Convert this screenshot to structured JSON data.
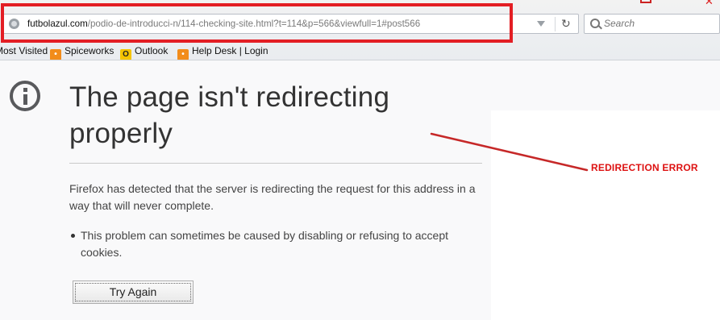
{
  "browser": {
    "url": {
      "host": "futbolazul.com",
      "path": "/podio-de-introducci-n/114-checking-site.html?t=114&p=566&viewfull=1#post566"
    },
    "search": {
      "placeholder": "Search"
    },
    "icons": [
      "globe-icon",
      "dropdown-icon",
      "reload-icon",
      "search-icon"
    ],
    "bookmarks": [
      {
        "label": "Most Visited",
        "icon": ""
      },
      {
        "label": "Spiceworks",
        "icon": "spiceworks-icon"
      },
      {
        "label": "Outlook",
        "icon": "outlook-icon"
      },
      {
        "label": "Help Desk | Login",
        "icon": "helpdesk-icon"
      }
    ]
  },
  "error": {
    "title": "The page isn't redirecting properly",
    "description": "Firefox has detected that the server is redirecting the request for this address in a way that will never complete.",
    "bullet": "This problem can sometimes be caused by disabling or refusing to accept cookies.",
    "button": "Try Again"
  },
  "annotation": {
    "label": "REDIRECTION ERROR",
    "highlight_color": "#e31e24",
    "text_color": "#dd1111"
  },
  "colors": {
    "page_bg": "#f9f9fa",
    "title": "#333333",
    "body_text": "#444444"
  }
}
